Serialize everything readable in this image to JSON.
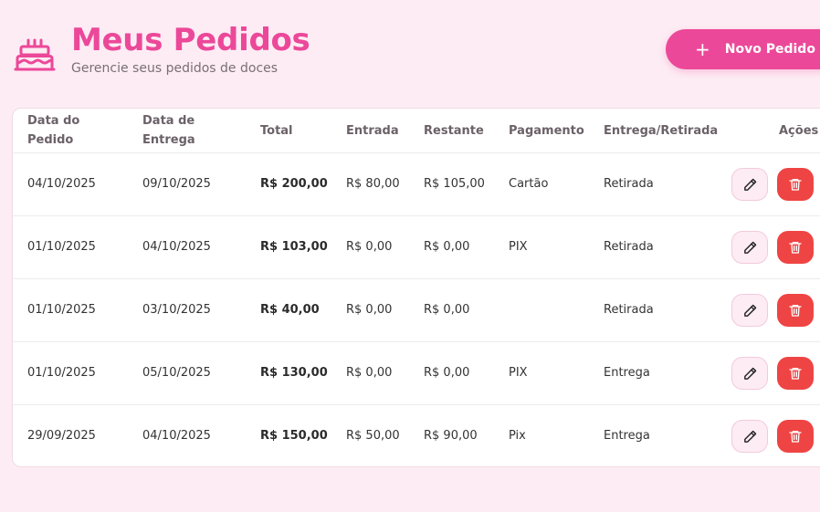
{
  "header": {
    "title": "Meus Pedidos",
    "subtitle": "Gerencie seus pedidos de doces",
    "icon": "cake-icon",
    "new_order_label": "Novo Pedido"
  },
  "colors": {
    "accent": "#ec4899",
    "background": "#fdecf4",
    "danger": "#ef4444"
  },
  "table": {
    "columns": {
      "order_date": "Data do Pedido",
      "delivery_date": "Data de Entrega",
      "total": "Total",
      "down_payment": "Entrada",
      "remaining": "Restante",
      "payment": "Pagamento",
      "delivery_pickup": "Entrega/Retirada",
      "actions": "Ações"
    },
    "rows": [
      {
        "order_date": "04/10/2025",
        "delivery_date": "09/10/2025",
        "total": "R$ 200,00",
        "down_payment": "R$ 80,00",
        "remaining": "R$ 105,00",
        "payment": "Cartão",
        "delivery_pickup": "Retirada"
      },
      {
        "order_date": "01/10/2025",
        "delivery_date": "04/10/2025",
        "total": "R$ 103,00",
        "down_payment": "R$ 0,00",
        "remaining": "R$ 0,00",
        "payment": "PIX",
        "delivery_pickup": "Retirada"
      },
      {
        "order_date": "01/10/2025",
        "delivery_date": "03/10/2025",
        "total": "R$ 40,00",
        "down_payment": "R$ 0,00",
        "remaining": "R$ 0,00",
        "payment": "",
        "delivery_pickup": "Retirada"
      },
      {
        "order_date": "01/10/2025",
        "delivery_date": "05/10/2025",
        "total": "R$ 130,00",
        "down_payment": "R$ 0,00",
        "remaining": "R$ 0,00",
        "payment": "PIX",
        "delivery_pickup": "Entrega"
      },
      {
        "order_date": "29/09/2025",
        "delivery_date": "04/10/2025",
        "total": "R$ 150,00",
        "down_payment": "R$ 50,00",
        "remaining": "R$ 90,00",
        "payment": "Pix",
        "delivery_pickup": "Entrega"
      }
    ],
    "row_actions": {
      "edit_icon": "pencil-icon",
      "delete_icon": "trash-icon"
    }
  }
}
